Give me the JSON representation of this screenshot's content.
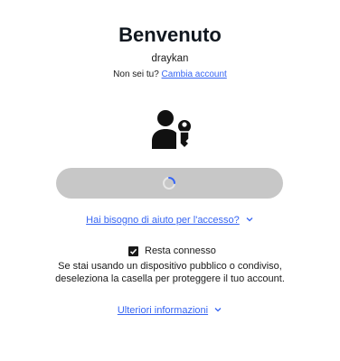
{
  "header": {
    "title": "Benvenuto",
    "username": "draykan",
    "not_you_prefix": "Non sei tu?",
    "switch_account_link": "Cambia account"
  },
  "passkey": {
    "icon": "user-key-icon"
  },
  "signin_button": {
    "state": "loading",
    "icon": "spinner-icon"
  },
  "help": {
    "link_label": "Hai bisogno di aiuto per l'accesso?",
    "icon": "chevron-down-icon"
  },
  "stay_signed_in": {
    "label": "Resta connesso",
    "checked": true,
    "info_text": "Se stai usando un dispositivo pubblico o condiviso, deseleziona la casella per proteggere il tuo account."
  },
  "more_info": {
    "link_label": "Ulteriori informazioni",
    "icon": "chevron-down-icon"
  },
  "colors": {
    "link": "#3665f3",
    "button_disabled": "#c7c7c7",
    "text": "#191919"
  }
}
